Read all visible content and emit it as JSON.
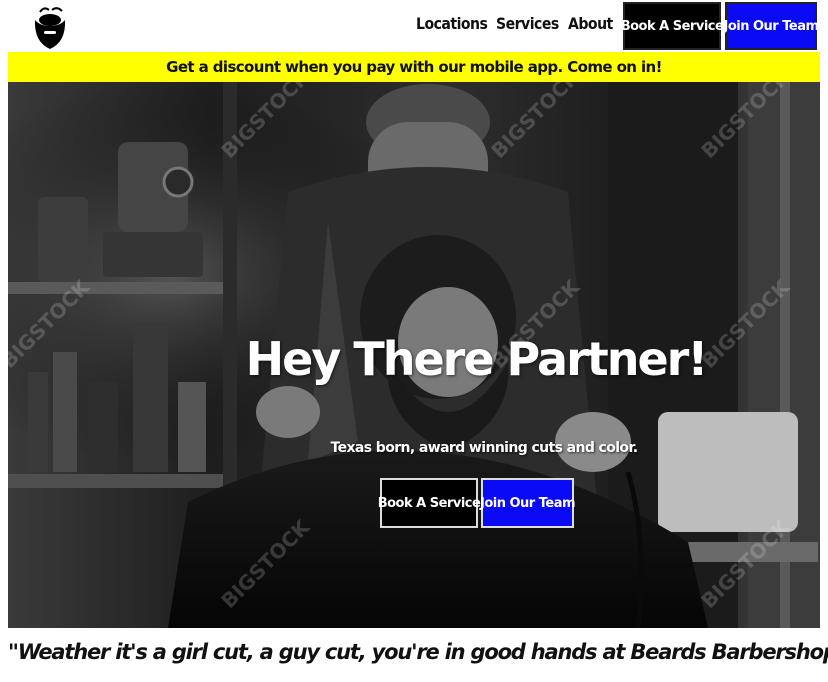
{
  "header": {
    "logo_icon": "bearded-man-logo-icon",
    "nav": [
      {
        "label": "Locations"
      },
      {
        "label": "Services"
      },
      {
        "label": "About"
      }
    ],
    "book_label": "Book A Service",
    "join_label": "Join Our Team"
  },
  "promo": {
    "text": "Get a discount when you pay with our mobile app. Come on in!",
    "background": "#ffff00"
  },
  "hero": {
    "title": "Hey There Partner!",
    "subtitle": "Texas born, award winning cuts and color.",
    "book_label": "Book A Service",
    "join_label": "Join Our Team",
    "image_alt": "barber-trimming-beard-photo",
    "watermark": "BIGSTOCK"
  },
  "quote": {
    "text": "\"Weather it's a girl cut, a guy cut, you're in good hands at Beards Barbershop\""
  },
  "colors": {
    "accent_blue": "#0a0af5",
    "black": "#000000",
    "banner_yellow": "#ffff00"
  }
}
